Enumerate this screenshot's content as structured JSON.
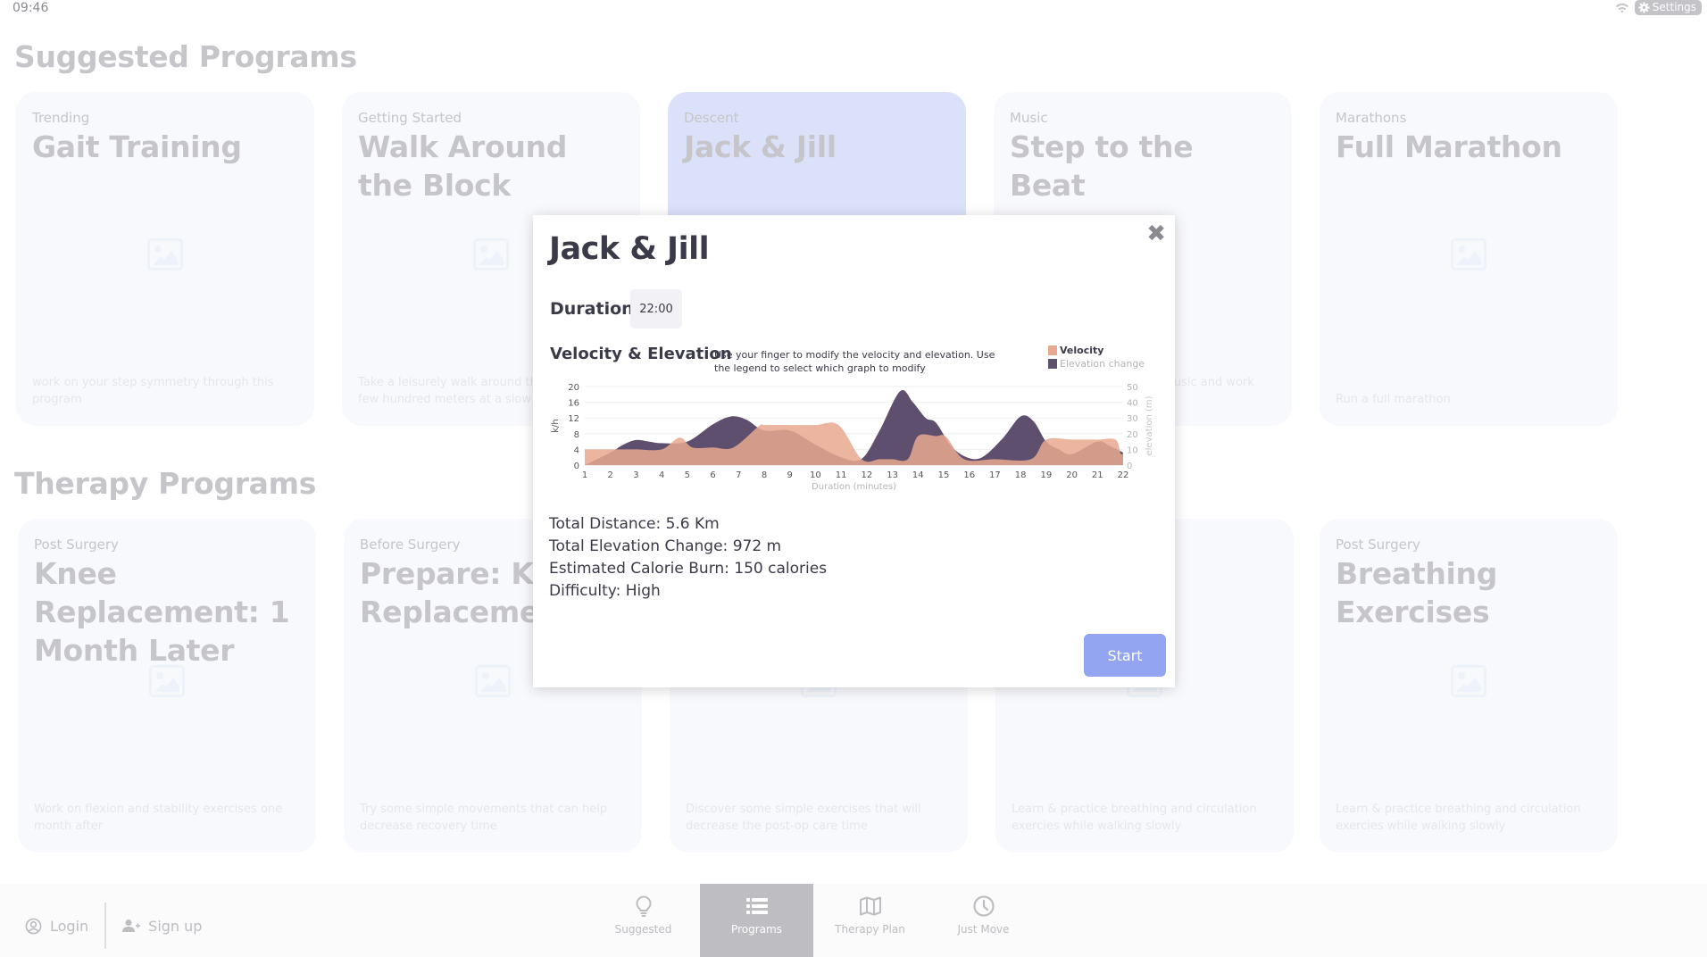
{
  "status_bar": {
    "time": "09:46",
    "settings_label": "Settings"
  },
  "sections": {
    "suggested_title": "Suggested Programs",
    "therapy_title": "Therapy Programs"
  },
  "suggested_cards": [
    {
      "category": "Trending",
      "title": "Gait Training",
      "description": "work on your step symmetry through this program"
    },
    {
      "category": "Getting Started",
      "title": "Walk Around the Block",
      "description": "Take a leisurely walk around the block for a few hundred meters at a slow pace"
    },
    {
      "category": "Descent",
      "title": "Jack & Jill",
      "description": ""
    },
    {
      "category": "Music",
      "title": "Step to the Beat",
      "description": "Walk to the rhythm of the music and work on your gait"
    },
    {
      "category": "Marathons",
      "title": "Full Marathon",
      "description": "Run a full marathon"
    }
  ],
  "therapy_cards": [
    {
      "category": "Post Surgery",
      "title": "Knee Replacement: 1 Month Later",
      "description": "Work on flexion and stability exercises one month after"
    },
    {
      "category": "Before Surgery",
      "title": "Prepare: Knee Replacement",
      "description": "Try some simple movements that can help decrease recovery time"
    },
    {
      "category": "",
      "title": "",
      "description": "Discover some simple exercises that will decrease the post-op care time"
    },
    {
      "category": "",
      "title": "",
      "description": "Learn & practice breathing and circulation exercies while walking slowly"
    },
    {
      "category": "Post Surgery",
      "title": "Breathing Exercises",
      "description": "Learn & practice breathing and circulation exercies while walking slowly"
    }
  ],
  "modal": {
    "title": "Jack & Jill",
    "close_icon": "close-icon",
    "duration_label": "Duration",
    "duration_value": "22:00",
    "chart_title": "Velocity & Elevation",
    "chart_hint": "Use your finger to modify the velocity and elevation. Use the legend to select which graph to modify",
    "stats": {
      "distance": "Total Distance: 5.6 Km",
      "elevation": "Total Elevation Change:  972 m",
      "calories": "Estimated Calorie Burn: 150 calories",
      "difficulty": "Difficulty: High"
    },
    "start_label": "Start"
  },
  "bottom_bar": {
    "login_label": "Login",
    "signup_label": "Sign up",
    "nav": [
      {
        "label": "Suggested",
        "icon": "lightbulb-icon",
        "active": false
      },
      {
        "label": "Programs",
        "icon": "list-icon",
        "active": true
      },
      {
        "label": "Therapy Plan",
        "icon": "map-icon",
        "active": false
      },
      {
        "label": "Just Move",
        "icon": "clock-icon",
        "active": false
      }
    ]
  },
  "colors": {
    "velocity": "#e7a88f",
    "elevation": "#5e4f6e",
    "accent": "#93a5f0",
    "selected_card": "#dce1fa"
  },
  "chart_data": {
    "type": "area",
    "title": "Velocity & Elevation",
    "xlabel": "Duration (minutes)",
    "ylabel": "k/h",
    "y2label": "elevation (m)",
    "x": [
      1,
      2,
      3,
      4,
      5,
      6,
      7,
      8,
      9,
      10,
      11,
      12,
      13,
      14,
      15,
      16,
      17,
      18,
      19,
      20,
      21,
      22
    ],
    "xlim": [
      1,
      22
    ],
    "ylim": [
      0,
      20
    ],
    "y2lim": [
      0,
      50
    ],
    "yticks": [
      0,
      4,
      8,
      12,
      16,
      20
    ],
    "y2ticks": [
      0,
      10,
      20,
      30,
      40,
      50
    ],
    "legend": [
      "Velocity",
      "Elevation change"
    ],
    "legend_position": "top-right",
    "series": [
      {
        "name": "Velocity",
        "axis": "left",
        "points": [
          [
            1,
            4
          ],
          [
            2.3,
            4
          ],
          [
            3,
            4
          ],
          [
            4,
            4
          ],
          [
            4.7,
            7
          ],
          [
            5.2,
            4.5
          ],
          [
            6,
            4.5
          ],
          [
            6.8,
            4.5
          ],
          [
            7.8,
            10
          ],
          [
            8,
            10.2
          ],
          [
            9,
            10.2
          ],
          [
            10,
            10.2
          ],
          [
            10.9,
            10.2
          ],
          [
            11.8,
            1.5
          ],
          [
            12.5,
            1.5
          ],
          [
            13,
            1.5
          ],
          [
            13.6,
            1.5
          ],
          [
            14,
            7.4
          ],
          [
            14.7,
            7.4
          ],
          [
            15.1,
            7.2
          ],
          [
            15.8,
            1.5
          ],
          [
            17,
            1.5
          ],
          [
            18.4,
            1.5
          ],
          [
            19,
            6.5
          ],
          [
            20,
            6.5
          ],
          [
            21,
            6.5
          ],
          [
            21.7,
            6.5
          ],
          [
            21.9,
            3
          ],
          [
            22,
            3
          ]
        ]
      },
      {
        "name": "Elevation change",
        "axis": "right",
        "points": [
          [
            1,
            0
          ],
          [
            2,
            8
          ],
          [
            2.5,
            13
          ],
          [
            3,
            16
          ],
          [
            3.5,
            15
          ],
          [
            4,
            14
          ],
          [
            5,
            15
          ],
          [
            6,
            26
          ],
          [
            6.7,
            31
          ],
          [
            7.3,
            29
          ],
          [
            8,
            22
          ],
          [
            9,
            22
          ],
          [
            10,
            13
          ],
          [
            11,
            5
          ],
          [
            11.8,
            4
          ],
          [
            12.5,
            22
          ],
          [
            13.3,
            47
          ],
          [
            13.8,
            40
          ],
          [
            14.3,
            30
          ],
          [
            14.7,
            27
          ],
          [
            15.3,
            12
          ],
          [
            15.9,
            5
          ],
          [
            16.5,
            5
          ],
          [
            17.3,
            17
          ],
          [
            18,
            31
          ],
          [
            18.5,
            28
          ],
          [
            19,
            15
          ],
          [
            19.5,
            10
          ],
          [
            20,
            7
          ],
          [
            21,
            15
          ],
          [
            21.5,
            12
          ],
          [
            22,
            8
          ]
        ]
      }
    ]
  }
}
